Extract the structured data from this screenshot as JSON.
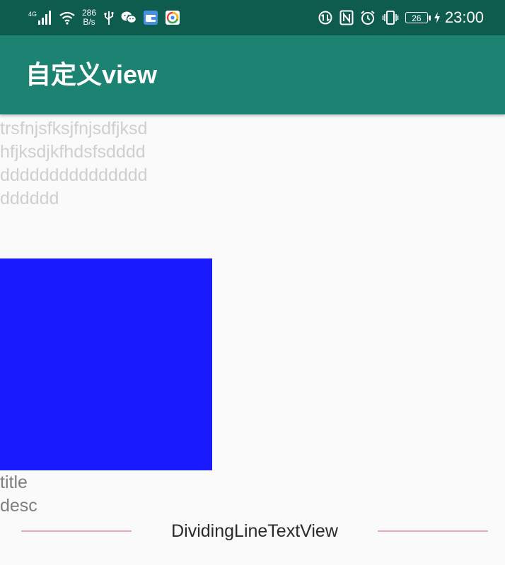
{
  "status_bar": {
    "network_type": "4G",
    "net_speed_value": "286",
    "net_speed_unit": "B/s",
    "battery_level": "26",
    "time": "23:00",
    "icons_left": [
      "signal-icon",
      "wifi-icon",
      "usb-icon",
      "wechat-icon",
      "wallet-icon",
      "browser-icon"
    ],
    "icons_right": [
      "data-saver-icon",
      "nfc-icon",
      "alarm-icon",
      "vibrate-icon",
      "battery-icon",
      "charging-icon"
    ]
  },
  "app_bar": {
    "title": "自定义view",
    "color": "#1c8373",
    "status_color": "#0d5c4d"
  },
  "content": {
    "wrap_text": "trsfnjsfksjfnjsdfjksdhfjksdjkfhdsfsddddddddddddddddddddddddd",
    "box_color": "#1a1aff",
    "title": "title",
    "desc": "desc",
    "divider_text": "DividingLineTextView",
    "divider_color": "#e6aab4"
  }
}
